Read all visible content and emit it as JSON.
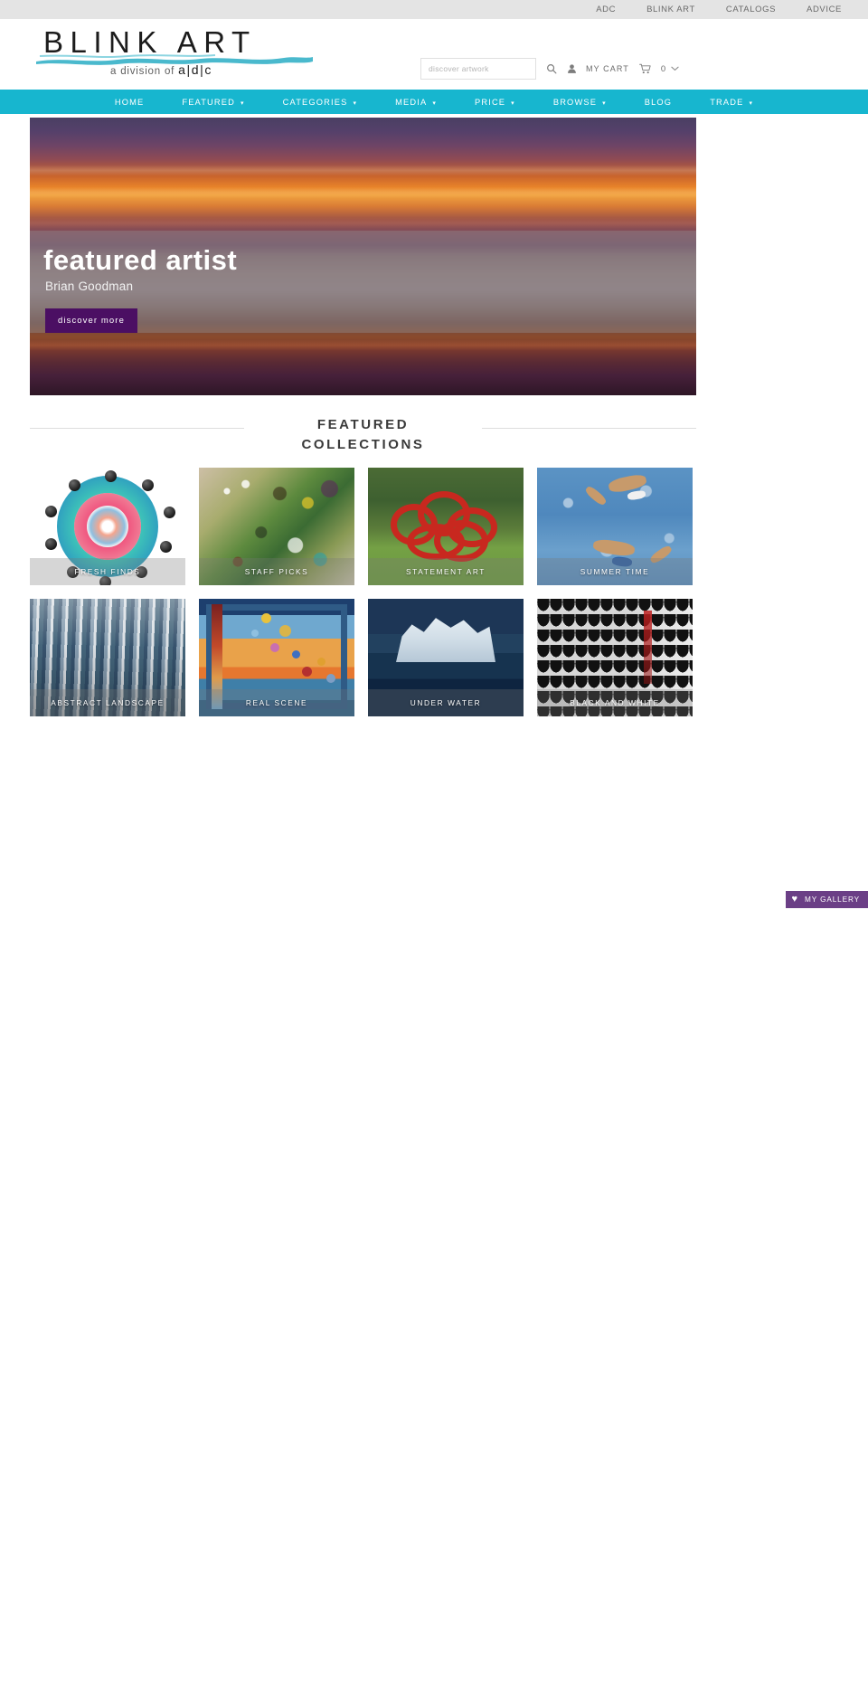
{
  "utility_bar": {
    "links": [
      {
        "label": "ADC",
        "name": "utility-link-adc"
      },
      {
        "label": "BLINK ART",
        "name": "utility-link-blink-art"
      },
      {
        "label": "CATALOGS",
        "name": "utility-link-catalogs"
      },
      {
        "label": "ADVICE",
        "name": "utility-link-advice"
      }
    ]
  },
  "logo": {
    "wordmark": "BLINK ART",
    "tagline_prefix": "a division of",
    "tagline_brand": "a|d|c"
  },
  "header_tools": {
    "search_placeholder": "discover artwork",
    "search_value": "",
    "search_icon": "search-icon",
    "account_icon": "user-icon",
    "cart_label": "MY CART",
    "cart_icon": "shopping-cart-icon",
    "cart_count": "0",
    "cart_caret": "⌄"
  },
  "main_nav": {
    "items": [
      {
        "label": "HOME",
        "has_dropdown": false
      },
      {
        "label": "FEATURED",
        "has_dropdown": true
      },
      {
        "label": "CATEGORIES",
        "has_dropdown": true
      },
      {
        "label": "MEDIA",
        "has_dropdown": true
      },
      {
        "label": "PRICE",
        "has_dropdown": true
      },
      {
        "label": "BROWSE",
        "has_dropdown": true
      },
      {
        "label": "BLOG",
        "has_dropdown": false
      },
      {
        "label": "TRADE",
        "has_dropdown": true
      }
    ],
    "caret_glyph": "⌄",
    "background_color": "#17b6cf"
  },
  "hero": {
    "title": "featured artist",
    "subtitle": "Brian Goodman",
    "cta_label": "discover more",
    "cta_color": "#4b0f63",
    "image_description": "blurred sunset seascape"
  },
  "featured_collections": {
    "heading_line1": "FEATURED",
    "heading_line2": "COLLECTIONS",
    "tiles": [
      {
        "label": "FRESH FINDS",
        "art": "mandala"
      },
      {
        "label": "STAFF PICKS",
        "art": "circles"
      },
      {
        "label": "STATEMENT ART",
        "art": "sculpture"
      },
      {
        "label": "SUMMER TIME",
        "art": "swim"
      },
      {
        "label": "ABSTRACT LANDSCAPE",
        "art": "abstract"
      },
      {
        "label": "REAL SCENE",
        "art": "real"
      },
      {
        "label": "UNDER WATER",
        "art": "ice"
      },
      {
        "label": "BLACK AND WHITE",
        "art": "bw"
      }
    ]
  },
  "gallery_tab": {
    "label": "MY GALLERY",
    "icon": "heart-icon",
    "color": "#6b3f86"
  }
}
